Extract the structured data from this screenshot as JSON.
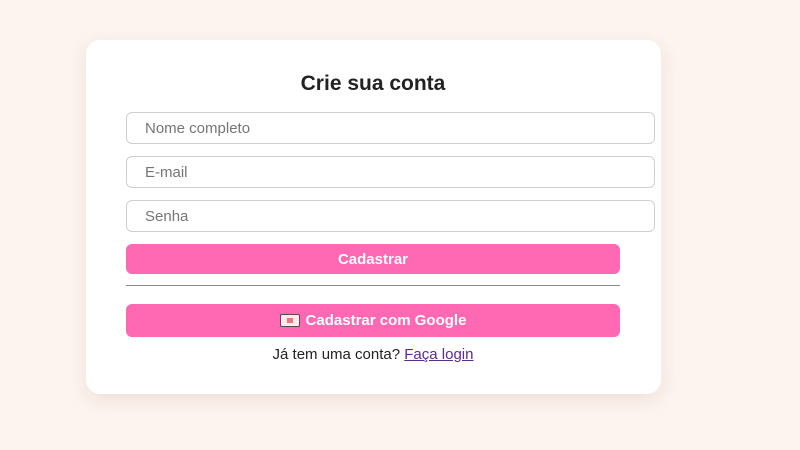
{
  "form": {
    "title": "Crie sua conta",
    "name_placeholder": "Nome completo",
    "email_placeholder": "E-mail",
    "password_placeholder": "Senha",
    "register_label": "Cadastrar",
    "google_label": "Cadastrar com Google",
    "google_icon": "google-envelope-icon",
    "login_prompt": "Já tem uma conta?",
    "login_link": "Faça login"
  },
  "colors": {
    "background": "#fdf4ef",
    "accent": "#ff69b4",
    "link": "#5b2c8d"
  }
}
